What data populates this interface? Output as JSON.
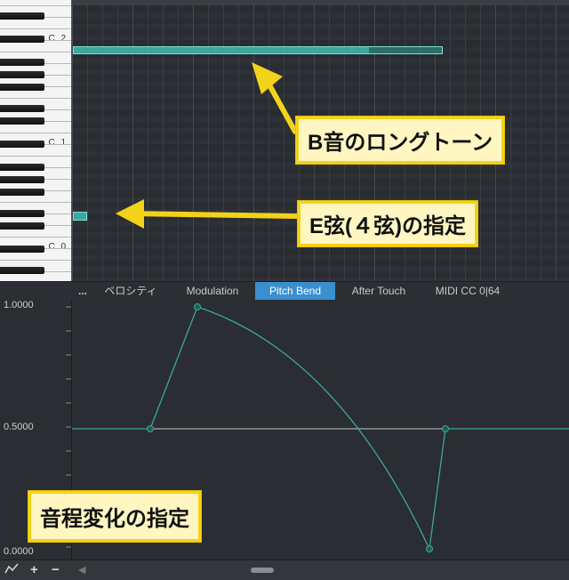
{
  "keyboard": {
    "octave_labels": [
      "C 2",
      "C 1",
      "C 0"
    ]
  },
  "tabs": {
    "more": "...",
    "items": [
      "ベロシティ",
      "Modulation",
      "Pitch Bend",
      "After Touch",
      "MIDI CC 0|64"
    ],
    "active": "Pitch Bend"
  },
  "lane": {
    "y_labels": [
      "1.0000",
      "0.5000",
      "0.0000"
    ],
    "curve_color": "#3aa89c",
    "point_color": "#1f5f58"
  },
  "bottombar": {
    "icons": [
      "curve-icon",
      "plus-icon",
      "minus-icon",
      "left-arrow-icon"
    ]
  },
  "callouts": {
    "long_tone": "B音のロングトーン",
    "e_string": "E弦(４弦)の指定",
    "pitch_change": "音程変化の指定"
  },
  "colors": {
    "accent": "#3b8fcf",
    "note": "#3aa89c",
    "callout_border": "#f3d21a",
    "callout_fill": "#fff6c2"
  }
}
